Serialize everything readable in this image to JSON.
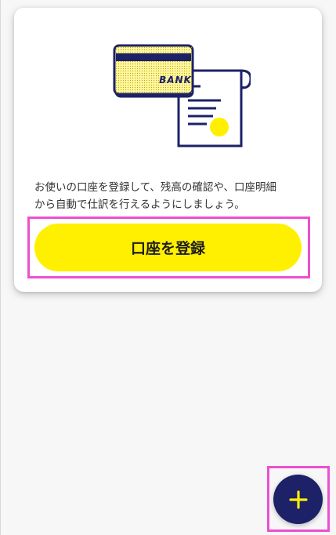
{
  "card": {
    "illustration": {
      "card_text": "BANK"
    },
    "description": "お使いの口座を登録して、残高の確認や、口座明細\nから自動で仕訳を行えるようにしましょう。",
    "register_button_label": "口座を登録"
  },
  "fab": {
    "icon": "plus-icon"
  },
  "colors": {
    "accent_yellow": "#ffef00",
    "navy": "#1c2168",
    "highlight": "#ec4fd0"
  }
}
